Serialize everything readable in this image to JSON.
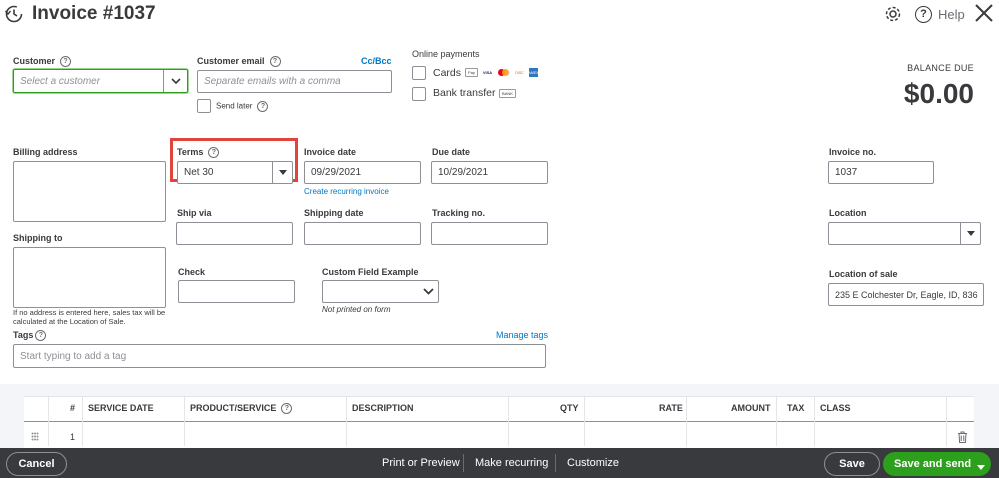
{
  "header": {
    "title": "Invoice #1037",
    "help_label": "Help"
  },
  "customer": {
    "label": "Customer",
    "placeholder": "Select a customer"
  },
  "customer_email": {
    "label": "Customer email",
    "placeholder": "Separate emails with a comma",
    "cc_bcc": "Cc/Bcc",
    "send_later": "Send later"
  },
  "online_payments": {
    "label": "Online payments",
    "cards": "Cards",
    "bank_transfer": "Bank transfer",
    "card_brands": [
      "Pay",
      "VISA",
      "MC",
      "DISC",
      "AMEX"
    ],
    "bank_badge": "BANK"
  },
  "balance": {
    "label": "BALANCE DUE",
    "amount": "$0.00"
  },
  "billing": {
    "label": "Billing address"
  },
  "terms": {
    "label": "Terms",
    "value": "Net 30"
  },
  "invoice_date": {
    "label": "Invoice date",
    "value": "09/29/2021",
    "recurring_link": "Create recurring invoice"
  },
  "due_date": {
    "label": "Due date",
    "value": "10/29/2021"
  },
  "invoice_no": {
    "label": "Invoice no.",
    "value": "1037"
  },
  "ship_via": {
    "label": "Ship via"
  },
  "shipping_date": {
    "label": "Shipping date"
  },
  "tracking_no": {
    "label": "Tracking no."
  },
  "location": {
    "label": "Location"
  },
  "shipping_to": {
    "label": "Shipping to",
    "note": "If no address is entered here, sales tax will be calculated at the Location of Sale."
  },
  "check": {
    "label": "Check"
  },
  "custom_field": {
    "label": "Custom Field Example",
    "note": "Not printed on form"
  },
  "location_of_sale": {
    "label": "Location of sale",
    "value": "235 E Colchester Dr, Eagle, ID, 836"
  },
  "tags": {
    "label": "Tags",
    "manage": "Manage tags",
    "placeholder": "Start typing to add a tag"
  },
  "table": {
    "headers": [
      "#",
      "SERVICE DATE",
      "PRODUCT/SERVICE",
      "DESCRIPTION",
      "QTY",
      "RATE",
      "AMOUNT",
      "TAX",
      "CLASS"
    ],
    "first_row_number": "1"
  },
  "footer": {
    "cancel": "Cancel",
    "print_preview": "Print or Preview",
    "make_recurring": "Make recurring",
    "customize": "Customize",
    "save": "Save",
    "save_and_send": "Save and send"
  },
  "colors": {
    "accent_green": "#2ca01c",
    "link_blue": "#0077c5",
    "highlight_red": "#e0443a",
    "footer_dark": "#393a3d"
  }
}
